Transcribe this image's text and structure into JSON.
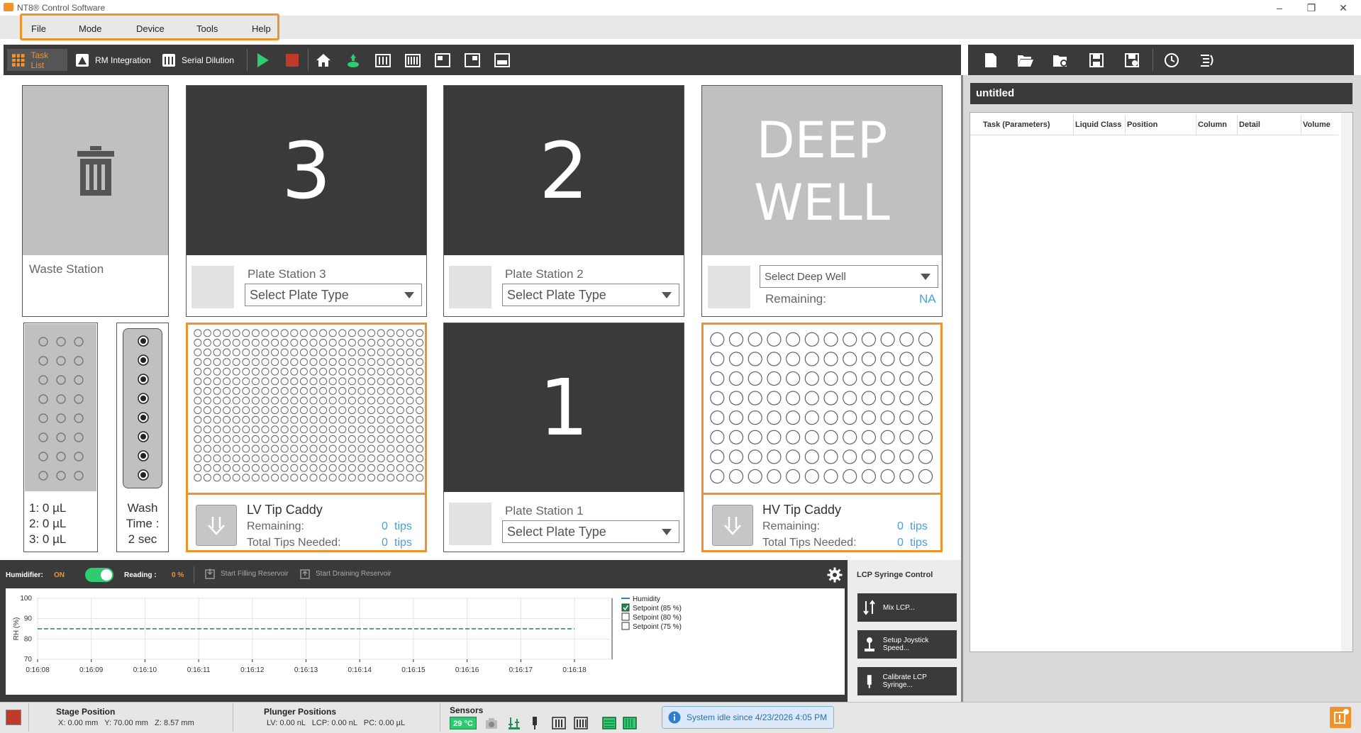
{
  "window": {
    "title": "NT8® Control Software"
  },
  "menu": [
    "File",
    "Mode",
    "Device",
    "Tools",
    "Help"
  ],
  "toolbar": {
    "task_list": "Task List",
    "rm_integration": "RM Integration",
    "serial_dilution": "Serial Dilution"
  },
  "stations": {
    "waste": {
      "label": "Waste Station"
    },
    "plate3": {
      "number": "3",
      "label": "Plate Station 3",
      "select": "Select Plate Type"
    },
    "plate2": {
      "number": "2",
      "label": "Plate Station 2",
      "select": "Select Plate Type"
    },
    "plate1": {
      "number": "1",
      "label": "Plate Station 1",
      "select": "Select Plate Type"
    },
    "deepwell": {
      "line1": "DEEP",
      "line2": "WELL",
      "select": "Select Deep Well",
      "remaining_label": "Remaining:",
      "remaining_value": "NA"
    },
    "volumes": [
      "1: 0 µL",
      "2: 0 µL",
      "3: 0 µL"
    ],
    "wash": {
      "line1": "Wash",
      "line2": "Time :",
      "line3": "2 sec"
    },
    "lv_caddy": {
      "title": "LV Tip Caddy",
      "remaining_label": "Remaining:",
      "remaining_value": "0",
      "remaining_unit": "tips",
      "needed_label": "Total Tips Needed:",
      "needed_value": "0",
      "needed_unit": "tips"
    },
    "hv_caddy": {
      "title": "HV Tip Caddy",
      "remaining_label": "Remaining:",
      "remaining_value": "0",
      "remaining_unit": "tips",
      "needed_label": "Total Tips Needed:",
      "needed_value": "0",
      "needed_unit": "tips"
    }
  },
  "humidity": {
    "humidifier_label": "Humidifier:",
    "humidifier_state": "ON",
    "reading_label": "Reading :",
    "reading_value": "0 %",
    "start_filling": "Start Filling Reservoir",
    "start_draining": "Start Draining Reservoir"
  },
  "chart_data": {
    "type": "line",
    "ylabel": "RH (%)",
    "ylim": [
      70,
      100
    ],
    "yticks": [
      "100",
      "90",
      "80",
      "70"
    ],
    "xticks": [
      "0:16:08",
      "0:16:09",
      "0:16:10",
      "0:16:11",
      "0:16:12",
      "0:16:13",
      "0:16:14",
      "0:16:15",
      "0:16:16",
      "0:16:17",
      "0:16:18"
    ],
    "series": [
      {
        "name": "Humidity",
        "values": [],
        "color": "#2a7fd0"
      },
      {
        "name": "Setpoint (85 %)",
        "values": [
          85,
          85,
          85,
          85,
          85,
          85,
          85,
          85,
          85,
          85,
          85
        ],
        "color": "#1a8a4a",
        "checked": true
      },
      {
        "name": "Setpoint (80 %)",
        "values": [],
        "checked": false
      },
      {
        "name": "Setpoint (75 %)",
        "values": [],
        "checked": false
      }
    ],
    "grid": true,
    "legend": "right"
  },
  "lcp": {
    "title": "LCP Syringe Control",
    "mix": "Mix LCP...",
    "joystick": "Setup Joystick Speed...",
    "calibrate": "Calibrate LCP Syringe..."
  },
  "right_panel": {
    "file_title": "untitled",
    "columns": [
      "Task (Parameters)",
      "Liquid Class",
      "Position",
      "Column",
      "Detail",
      "Volume"
    ]
  },
  "status": {
    "stage_label": "Stage Position",
    "stage_value": "X: 0.00 mm   Y: 70.00 mm   Z: 8.57 mm",
    "plunger_label": "Plunger Positions",
    "plunger_value": "LV: 0.00 nL   LCP: 0.00 nL   PC: 0.00 µL",
    "sensors_label": "Sensors",
    "sensor_temp": "29 °C",
    "idle_message": "System idle since 4/23/2026 4:05 PM"
  },
  "colors": {
    "accent": "#f0932b",
    "dark": "#3a3a3a",
    "blue": "#4a9fd8",
    "green": "#2ecc71"
  }
}
